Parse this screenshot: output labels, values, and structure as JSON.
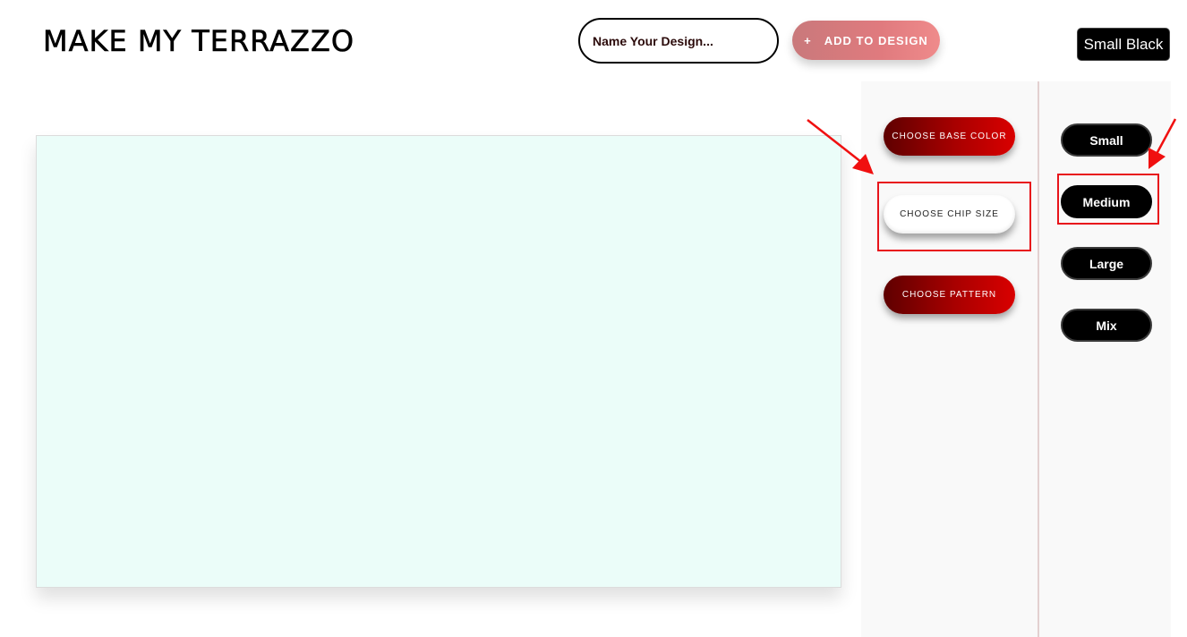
{
  "header": {
    "brand_title": "MAKE MY TERRAZZO",
    "name_input_placeholder": "Name Your Design...",
    "add_button_icon": "+",
    "add_button_label": "ADD TO DESIGN",
    "current_selection": "Small Black"
  },
  "options": {
    "base_color_label": "CHOOSE BASE COLOR",
    "chip_size_label": "CHOOSE CHIP SIZE",
    "pattern_label": "CHOOSE PATTERN"
  },
  "chip_sizes": [
    {
      "label": "Small"
    },
    {
      "label": "Medium"
    },
    {
      "label": "Large"
    },
    {
      "label": "Mix"
    }
  ],
  "colors": {
    "canvas_background": "#ebfdf9",
    "accent_red": "#a90000",
    "annotation_red": "#e8141b",
    "button_black": "#000000"
  },
  "icons": {
    "annotation": "red-arrow-icon"
  }
}
